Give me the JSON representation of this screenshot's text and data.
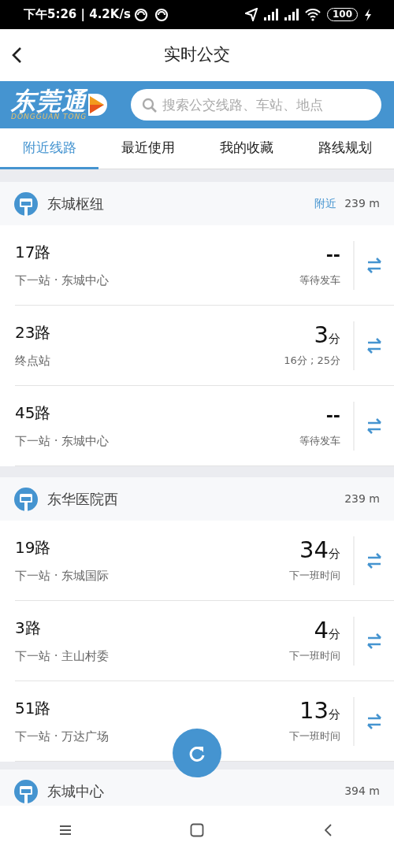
{
  "status_bar": {
    "time": "下午5:26 | 4.2K/s",
    "battery": "100"
  },
  "header": {
    "title": "实时公交"
  },
  "banner": {
    "logo_text": "东莞通",
    "logo_subtitle": "DONGGUAN TONG",
    "search": {
      "placeholder": "搜索公交线路、车站、地点"
    }
  },
  "tabs": [
    {
      "label": "附近线路",
      "selected": true
    },
    {
      "label": "最近使用",
      "selected": false
    },
    {
      "label": "我的收藏",
      "selected": false
    },
    {
      "label": "路线规划",
      "selected": false
    }
  ],
  "stations": [
    {
      "name": "东城枢纽",
      "tag": "附近",
      "distance": "239 m",
      "routes": [
        {
          "route": "17路",
          "info": "下一站 · 东城中心",
          "kind": "waiting",
          "eta": "--",
          "note": "等待发车"
        },
        {
          "route": "23路",
          "info": "终点站",
          "kind": "minutes",
          "eta": "3",
          "unit": "分",
          "note": "16分 ; 25分"
        },
        {
          "route": "45路",
          "info": "下一站 · 东城中心",
          "kind": "waiting",
          "eta": "--",
          "note": "等待发车"
        }
      ]
    },
    {
      "name": "东华医院西",
      "distance": "239 m",
      "routes": [
        {
          "route": "19路",
          "info": "下一站 · 东城国际",
          "kind": "minutes",
          "eta": "34",
          "unit": "分",
          "note": "下一班时间"
        },
        {
          "route": "3路",
          "info": "下一站 · 主山村委",
          "kind": "minutes",
          "eta": "4",
          "unit": "分",
          "note": "下一班时间"
        },
        {
          "route": "51路",
          "info": "下一站 · 万达广场",
          "kind": "minutes",
          "eta": "13",
          "unit": "分",
          "note": "下一班时间"
        }
      ]
    },
    {
      "name": "东城中心",
      "distance": "394 m"
    }
  ]
}
